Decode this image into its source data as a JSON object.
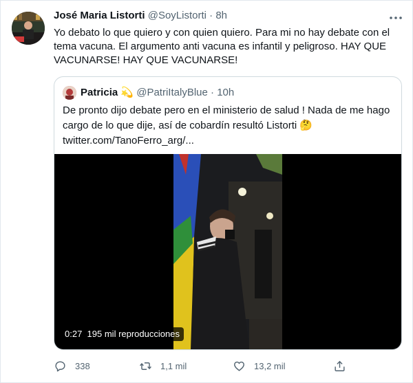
{
  "tweet": {
    "author_name": "José Maria Listorti",
    "author_handle": "@SoyListorti",
    "separator": "·",
    "time": "8h",
    "more_icon": "more-dots-icon",
    "text": "Yo debato lo que quiero y con quien quiero. Para mi no hay debate con el tema vacuna. El argumento anti vacuna es infantil y peligroso. HAY QUE VACUNARSE! HAY QUE VACUNARSE!"
  },
  "quote": {
    "author_name": "Patricia",
    "author_emoji": "💫",
    "author_handle": "@PatriItalyBlue",
    "separator": "·",
    "time": "10h",
    "text_line1": "De pronto dijo debate pero en el ministerio de salud ! Nada de me hago",
    "text_line2": "cargo de lo que dije, así de cobardín resultó Listorti",
    "text_emoji": "🤔",
    "link": "twitter.com/TanoFerro_arg/...",
    "video": {
      "duration": "0:27",
      "views": "195 mil reproducciones"
    }
  },
  "actions": {
    "reply": {
      "icon": "reply-icon",
      "count": "338"
    },
    "retweet": {
      "icon": "retweet-icon",
      "count": "1,1 mil"
    },
    "like": {
      "icon": "heart-icon",
      "count": "13,2 mil"
    },
    "share": {
      "icon": "share-icon"
    }
  },
  "colors": {
    "text": "#0f1419",
    "secondary": "#536471",
    "border": "#cfd9de"
  }
}
